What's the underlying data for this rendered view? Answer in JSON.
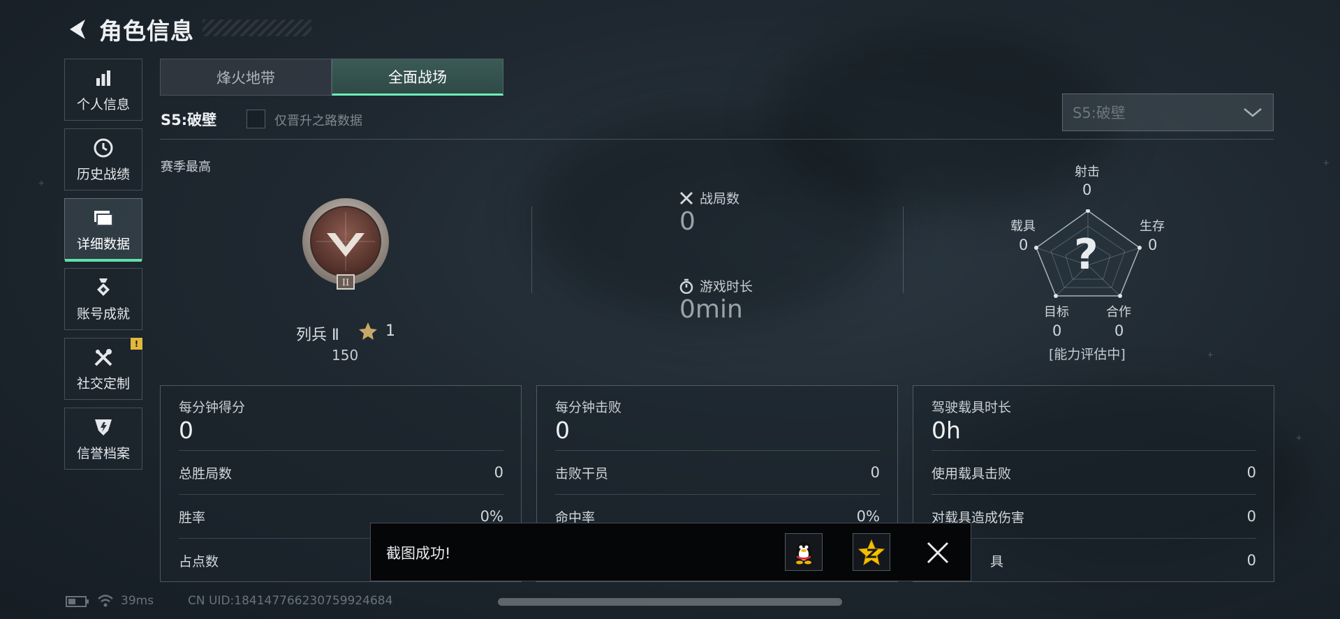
{
  "header": {
    "title": "角色信息"
  },
  "sidebar": {
    "items": [
      {
        "label": "个人信息",
        "icon": "bar-chart-icon"
      },
      {
        "label": "历史战绩",
        "icon": "clock-icon"
      },
      {
        "label": "详细数据",
        "icon": "folder-icon",
        "active": true
      },
      {
        "label": "账号成就",
        "icon": "medal-icon"
      },
      {
        "label": "社交定制",
        "icon": "tools-icon",
        "badge": "!"
      },
      {
        "label": "信誉档案",
        "icon": "shield-icon"
      }
    ]
  },
  "tabs": [
    {
      "label": "烽火地带",
      "active": false
    },
    {
      "label": "全面战场",
      "active": true
    }
  ],
  "season": {
    "name": "S5:破壁",
    "filter_label": "仅晋升之路数据",
    "filter_checked": false,
    "select_value": "S5:破壁"
  },
  "best": {
    "label": "赛季最高",
    "rank_name": "列兵 Ⅱ",
    "stars": "1",
    "points": "150"
  },
  "summary": {
    "matches_label": "战局数",
    "matches_value": "0",
    "time_label": "游戏时长",
    "time_value": "0min"
  },
  "radar": {
    "center": "?",
    "status": "[能力评估中]",
    "axes": [
      {
        "label": "射击",
        "value": "0"
      },
      {
        "label": "生存",
        "value": "0"
      },
      {
        "label": "合作",
        "value": "0"
      },
      {
        "label": "目标",
        "value": "0"
      },
      {
        "label": "载具",
        "value": "0"
      }
    ]
  },
  "cards": [
    {
      "title": "每分钟得分",
      "value": "0",
      "rows": [
        {
          "label": "总胜局数",
          "value": "0"
        },
        {
          "label": "胜率",
          "value": "0%"
        },
        {
          "label": "占点数",
          "value": ""
        }
      ]
    },
    {
      "title": "每分钟击败",
      "value": "0",
      "rows": [
        {
          "label": "击败干员",
          "value": "0"
        },
        {
          "label": "命中率",
          "value": "0%"
        },
        {
          "label": "",
          "value": ""
        }
      ]
    },
    {
      "title": "驾驶载具时长",
      "value": "0h",
      "rows": [
        {
          "label": "使用载具击败",
          "value": "0"
        },
        {
          "label": "对载具造成伤害",
          "value": "0"
        },
        {
          "label": "具",
          "value": "0"
        }
      ]
    }
  ],
  "toast": {
    "text": "截图成功!"
  },
  "footer": {
    "ping": "39ms",
    "uid": "CN UID:1841477662307599246​84"
  },
  "colors": {
    "accent": "#6ff0b8",
    "badge": "#e2b83c",
    "toast_bg": "#050607"
  }
}
